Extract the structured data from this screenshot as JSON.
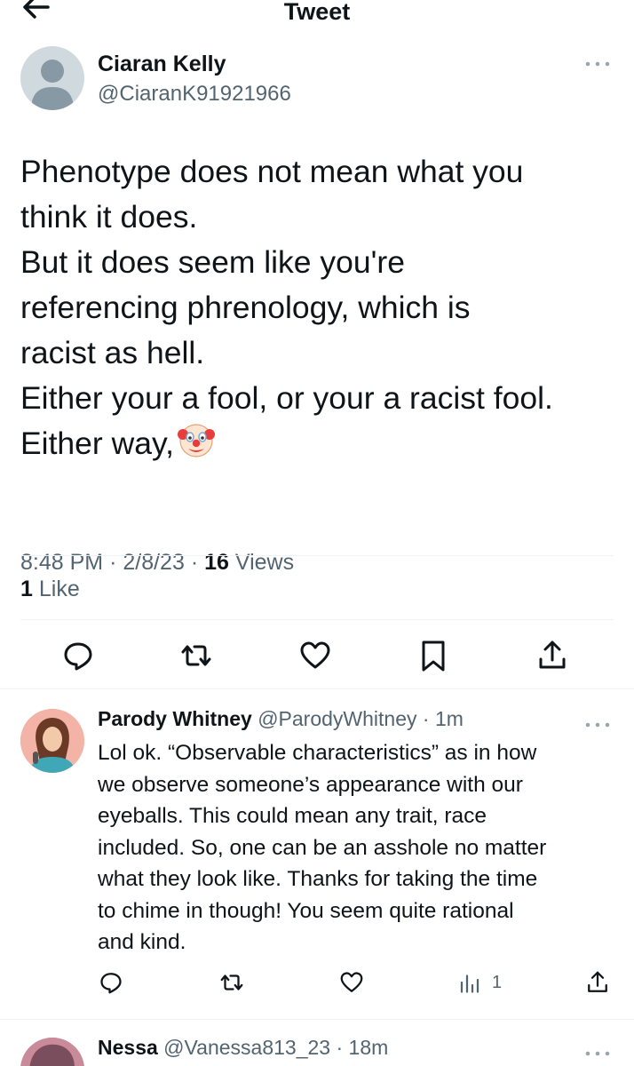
{
  "header": {
    "title": "Tweet"
  },
  "tweet": {
    "author_name": "Ciaran Kelly",
    "author_handle": "@CiaranK91921966",
    "lines": [
      "Phenotype does not mean what you",
      "think it does.",
      "But it does seem like you're",
      "referencing phrenology, which is",
      "racist as hell.",
      "Either your a fool, or your a racist fool.",
      "Either way,"
    ],
    "emoji": "clown-face-emoji",
    "time": "8:48 PM",
    "date": "2/8/23",
    "views_count": "16",
    "views_label": "Views",
    "likes_count": "1",
    "likes_label": "Like"
  },
  "reply": {
    "author_name": "Parody Whitney",
    "author_handle": "@ParodyWhitney",
    "age": "1m",
    "lines": [
      "Lol ok. “Observable characteristics” as in how",
      "we observe someone’s appearance with our",
      "eyeballs. This could mean any trait, race",
      "included. So, one can be an asshole no matter",
      "what they look like. Thanks for taking the time",
      "to chime in though! You seem quite rational",
      "and kind."
    ],
    "analytics_count": "1"
  },
  "next_reply": {
    "author_name": "Nessa",
    "author_handle": "@Vanessa813_23",
    "age": "18m"
  },
  "icons": {
    "back": "arrow-left-icon",
    "more": "more-horizontal-icon",
    "reply": "reply-bubble-icon",
    "retweet": "retweet-icon",
    "like": "heart-icon",
    "bookmark": "bookmark-icon",
    "share": "share-icon",
    "analytics": "analytics-bars-icon"
  },
  "colors": {
    "text": "#0f1419",
    "secondary": "#536471",
    "divider": "#eff3f4"
  }
}
